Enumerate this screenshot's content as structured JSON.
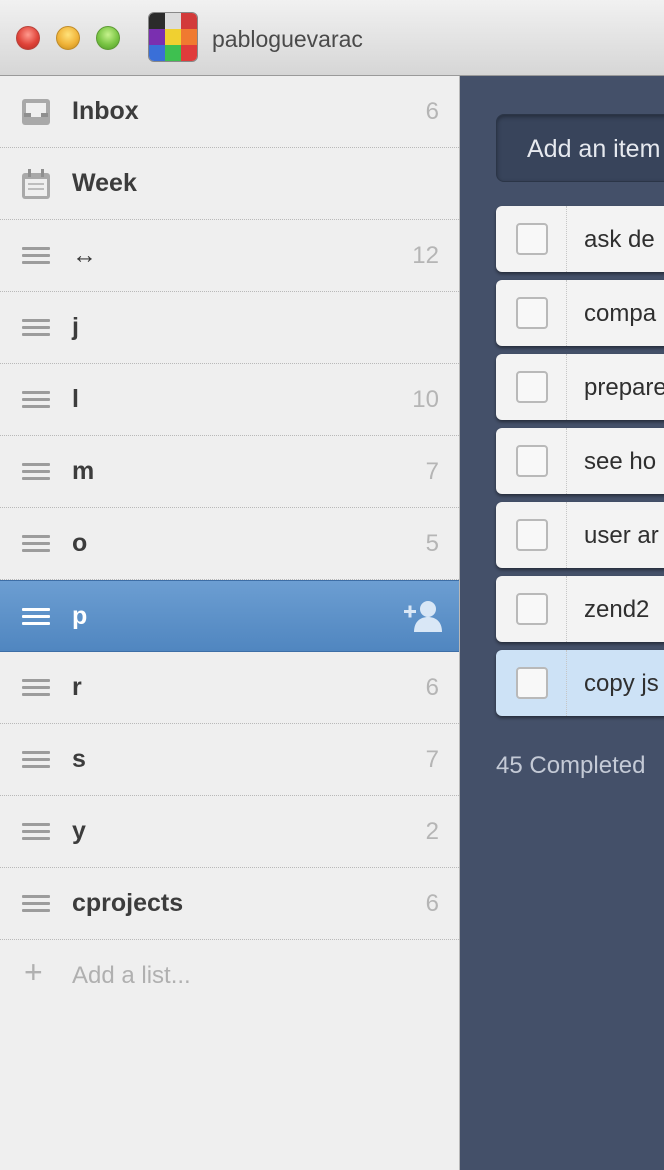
{
  "window": {
    "username": "pabloguevarac",
    "avatar_colors": [
      "#2b2b2b",
      "#dcdcdc",
      "#d23a3a",
      "#7a2fb0",
      "#f0d030",
      "#f07a30",
      "#3a6fd8",
      "#3ec050",
      "#e03b3b"
    ]
  },
  "sidebar": {
    "items": [
      {
        "label": "Inbox",
        "count": "6",
        "icon": "inbox-icon"
      },
      {
        "label": "Week",
        "count": "",
        "icon": "calendar-icon"
      },
      {
        "label": "↔",
        "count": "12",
        "icon": "list-icon"
      },
      {
        "label": "j",
        "count": "",
        "icon": "list-icon"
      },
      {
        "label": "l",
        "count": "10",
        "icon": "list-icon"
      },
      {
        "label": "m",
        "count": "7",
        "icon": "list-icon"
      },
      {
        "label": "o",
        "count": "5",
        "icon": "list-icon"
      },
      {
        "label": "p",
        "count": "",
        "icon": "list-icon",
        "selected": true
      },
      {
        "label": "r",
        "count": "6",
        "icon": "list-icon"
      },
      {
        "label": "s",
        "count": "7",
        "icon": "list-icon"
      },
      {
        "label": "y",
        "count": "2",
        "icon": "list-icon"
      },
      {
        "label": "cprojects",
        "count": "6",
        "icon": "list-icon"
      }
    ],
    "add_list": "Add a list..."
  },
  "main": {
    "add_item_placeholder": "Add an item",
    "tasks": [
      {
        "text": "ask de"
      },
      {
        "text": "compa"
      },
      {
        "text": "prepare"
      },
      {
        "text": "see ho"
      },
      {
        "text": "user ar"
      },
      {
        "text": "zend2"
      },
      {
        "text": "copy js",
        "highlighted": true
      }
    ],
    "completed_label": "45 Completed"
  },
  "colors": {
    "accent": "#5b8fc9",
    "main_bg": "#445069",
    "sidebar_bg": "#efefef"
  }
}
